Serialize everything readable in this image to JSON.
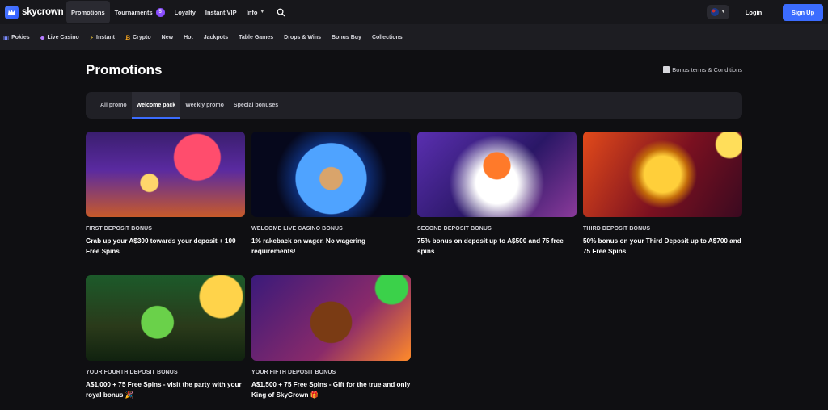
{
  "header": {
    "logo_text": "skycrown",
    "nav": [
      {
        "label": "Promotions",
        "active": true
      },
      {
        "label": "Tournaments",
        "badge": "5"
      },
      {
        "label": "Loyalty"
      },
      {
        "label": "Instant VIP"
      },
      {
        "label": "Info"
      }
    ],
    "login_label": "Login",
    "signup_label": "Sign Up",
    "accent_color": "#3b6cff"
  },
  "categories": [
    {
      "label": "Pokies",
      "icon": "pokies-icon"
    },
    {
      "label": "Live Casino",
      "icon": "live-casino-icon"
    },
    {
      "label": "Instant",
      "icon": "lightning-icon"
    },
    {
      "label": "Crypto",
      "icon": "bitcoin-icon"
    },
    {
      "label": "New"
    },
    {
      "label": "Hot"
    },
    {
      "label": "Jackpots"
    },
    {
      "label": "Table Games"
    },
    {
      "label": "Drops & Wins"
    },
    {
      "label": "Bonus Buy"
    },
    {
      "label": "Collections"
    }
  ],
  "page": {
    "title": "Promotions",
    "terms_label": "Bonus terms & Conditions",
    "tabs": [
      {
        "label": "All promo"
      },
      {
        "label": "Welcome pack",
        "active": true
      },
      {
        "label": "Weekly promo"
      },
      {
        "label": "Special bonuses"
      }
    ]
  },
  "promotions": [
    {
      "label": "FIRST DEPOSIT BONUS",
      "description": "Grab up your A$300 towards your deposit + 100 Free Spins"
    },
    {
      "label": "WELCOME LIVE CASINO BONUS",
      "description": "1% rakeback on wager. No wagering requirements!"
    },
    {
      "label": "SECOND DEPOSIT BONUS",
      "description": "75% bonus on deposit up to A$500 and 75 free spins"
    },
    {
      "label": "THIRD DEPOSIT BONUS",
      "description": "50% bonus on your Third Deposit up to A$700 and 75 Free Spins"
    },
    {
      "label": "YOUR FOURTH DEPOSIT BONUS",
      "description": "A$1,000 + 75 Free Spins - visit the party with your royal bonus 🎉"
    },
    {
      "label": "YOUR FIFTH DEPOSIT BONUS",
      "description": "A$1,500 + 75 Free Spins - Gift for the true and only King of SkyCrown 🎁"
    }
  ]
}
